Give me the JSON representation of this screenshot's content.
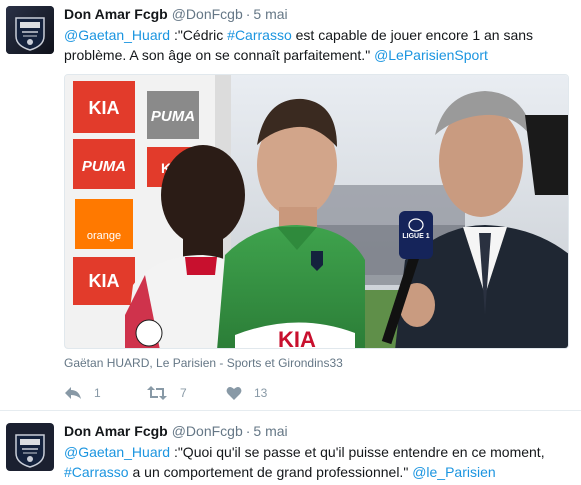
{
  "tweets": [
    {
      "author": {
        "name": "Don Amar Fcgb",
        "handle": "@DonFcgb"
      },
      "separator": "·",
      "date": "5 mai",
      "segments": [
        {
          "text": "@Gaetan_Huard",
          "link": true
        },
        {
          "text": " :\"Cédric ",
          "link": false
        },
        {
          "text": "#Carrasso",
          "link": true
        },
        {
          "text": " est capable de jouer encore 1 an sans problème. A son âge on se connaît parfaitement.\" ",
          "link": false
        },
        {
          "text": "@LeParisienSport",
          "link": true
        }
      ],
      "media": {
        "ad_boards": [
          "KIA",
          "PUMA",
          "KIA",
          "PUMA",
          "orange",
          "KIA"
        ],
        "mic_logo": "LIGUE 1",
        "shirt_sponsor": "KIA",
        "credit": "Gaëtan HUARD, Le Parisien - Sports et Girondins33"
      },
      "actions": {
        "replies": "1",
        "retweets": "7",
        "likes": "13"
      }
    },
    {
      "author": {
        "name": "Don Amar Fcgb",
        "handle": "@DonFcgb"
      },
      "separator": "·",
      "date": "5 mai",
      "segments": [
        {
          "text": "@Gaetan_Huard",
          "link": true
        },
        {
          "text": " :\"Quoi qu'il se passe et qu'il puisse entendre en ce moment, ",
          "link": false
        },
        {
          "text": "#Carrasso",
          "link": true
        },
        {
          "text": " a un comportement de grand professionnel.\" ",
          "link": false
        },
        {
          "text": "@le_Parisien",
          "link": true
        }
      ]
    }
  ],
  "colors": {
    "link": "#1b95e0",
    "meta": "#657786",
    "icon": "#8899a6",
    "divider": "#e6ecf0"
  },
  "icons": {
    "reply": "reply-icon",
    "retweet": "retweet-icon",
    "like": "heart-icon"
  }
}
